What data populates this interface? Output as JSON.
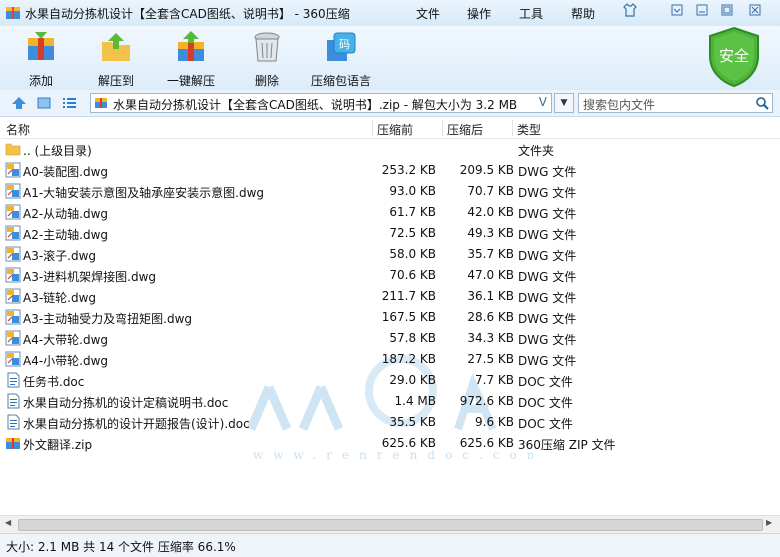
{
  "window": {
    "title": "水果自动分拣机设计【全套含CAD图纸、说明书】 - 360压缩",
    "menu": [
      "文件",
      "操作",
      "工具",
      "帮助"
    ]
  },
  "toolbar": [
    {
      "label": "添加",
      "icon": "add-archive-icon"
    },
    {
      "label": "解压到",
      "icon": "extract-to-icon"
    },
    {
      "label": "一键解压",
      "icon": "one-click-extract-icon"
    },
    {
      "label": "删除",
      "icon": "trash-icon"
    },
    {
      "label": "压缩包语言",
      "icon": "archive-language-icon"
    }
  ],
  "security_badge": "安全",
  "address": {
    "path": "水果自动分拣机设计【全套含CAD图纸、说明书】.zip - 解包大小为 3.2 MB",
    "search_placeholder": "搜索包内文件"
  },
  "columns": {
    "name": "名称",
    "compressed": "压缩前",
    "original": "压缩后",
    "type": "类型"
  },
  "files": [
    {
      "name": ".. (上级目录)",
      "compressed": "",
      "original": "",
      "type": "文件夹",
      "icon": "folder-icon"
    },
    {
      "name": "A0-装配图.dwg",
      "compressed": "253.2 KB",
      "original": "209.5 KB",
      "type": "DWG 文件",
      "icon": "dwg-file-icon"
    },
    {
      "name": "A1-大轴安装示意图及轴承座安装示意图.dwg",
      "compressed": "93.0 KB",
      "original": "70.7 KB",
      "type": "DWG 文件",
      "icon": "dwg-file-icon"
    },
    {
      "name": "A2-从动轴.dwg",
      "compressed": "61.7 KB",
      "original": "42.0 KB",
      "type": "DWG 文件",
      "icon": "dwg-file-icon"
    },
    {
      "name": "A2-主动轴.dwg",
      "compressed": "72.5 KB",
      "original": "49.3 KB",
      "type": "DWG 文件",
      "icon": "dwg-file-icon"
    },
    {
      "name": "A3-滚子.dwg",
      "compressed": "58.0 KB",
      "original": "35.7 KB",
      "type": "DWG 文件",
      "icon": "dwg-file-icon"
    },
    {
      "name": "A3-进料机架焊接图.dwg",
      "compressed": "70.6 KB",
      "original": "47.0 KB",
      "type": "DWG 文件",
      "icon": "dwg-file-icon"
    },
    {
      "name": "A3-链轮.dwg",
      "compressed": "211.7 KB",
      "original": "36.1 KB",
      "type": "DWG 文件",
      "icon": "dwg-file-icon"
    },
    {
      "name": "A3-主动轴受力及弯扭矩图.dwg",
      "compressed": "167.5 KB",
      "original": "28.6 KB",
      "type": "DWG 文件",
      "icon": "dwg-file-icon"
    },
    {
      "name": "A4-大带轮.dwg",
      "compressed": "57.8 KB",
      "original": "34.3 KB",
      "type": "DWG 文件",
      "icon": "dwg-file-icon"
    },
    {
      "name": "A4-小带轮.dwg",
      "compressed": "187.2 KB",
      "original": "27.5 KB",
      "type": "DWG 文件",
      "icon": "dwg-file-icon"
    },
    {
      "name": "任务书.doc",
      "compressed": "29.0 KB",
      "original": "7.7 KB",
      "type": "DOC 文件",
      "icon": "doc-file-icon"
    },
    {
      "name": "水果自动分拣机的设计定稿说明书.doc",
      "compressed": "1.4 MB",
      "original": "972.6 KB",
      "type": "DOC 文件",
      "icon": "doc-file-icon"
    },
    {
      "name": "水果自动分拣机的设计开题报告(设计).doc",
      "compressed": "35.5 KB",
      "original": "9.6 KB",
      "type": "DOC 文件",
      "icon": "doc-file-icon"
    },
    {
      "name": "外文翻译.zip",
      "compressed": "625.6 KB",
      "original": "625.6 KB",
      "type": "360压缩 ZIP 文件",
      "icon": "zip-file-icon"
    }
  ],
  "watermark": {
    "text": "人人文库",
    "url": "www.renrendoc.com"
  },
  "status": "大小: 2.1 MB 共 14 个文件 压缩率 66.1%"
}
